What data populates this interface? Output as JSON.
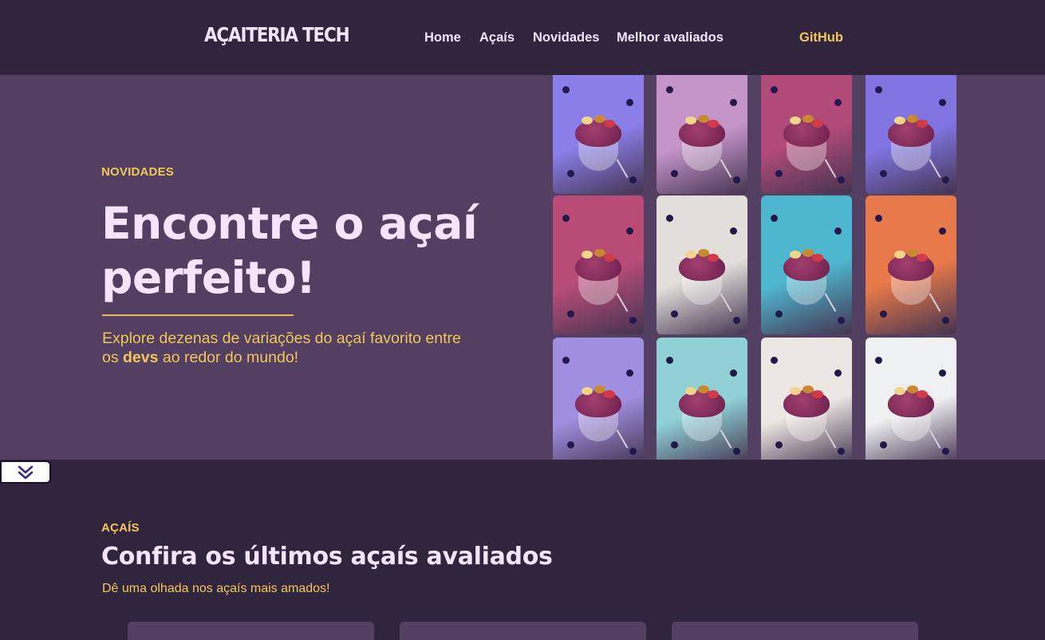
{
  "header": {
    "logo": "AÇAITERIA TECH",
    "nav": [
      {
        "label": "Home"
      },
      {
        "label": "Açaís"
      },
      {
        "label": "Novidades"
      },
      {
        "label": "Melhor avaliados"
      }
    ],
    "github_label": "GitHub"
  },
  "hero": {
    "eyebrow": "NOVIDADES",
    "title": "Encontre o açaí perfeito!",
    "description_before": "Explore dezenas de variações do açaí favorito entre os ",
    "description_highlight": "devs",
    "description_after": " ao redor do mundo!",
    "photos": [
      {
        "name": "acai-photo-glass-on-purple",
        "bg": "#8a7ee8"
      },
      {
        "name": "acai-photo-bowl-on-lilac",
        "bg": "#c594c9"
      },
      {
        "name": "acai-photo-kiwi-on-pink",
        "bg": "#b04a78"
      },
      {
        "name": "acai-photo-goblet-on-purple",
        "bg": "#7f74e0"
      },
      {
        "name": "acai-photo-cup-on-pink",
        "bg": "#b84c77"
      },
      {
        "name": "acai-photo-coconut-bowl",
        "bg": "#e2dfdb"
      },
      {
        "name": "acai-photo-cup-on-cyan",
        "bg": "#4fb6cf"
      },
      {
        "name": "acai-photo-cup-on-orange",
        "bg": "#e8794a"
      },
      {
        "name": "acai-photo-banana-on-lavender",
        "bg": "#a08ee0"
      },
      {
        "name": "acai-photo-cup-on-aqua",
        "bg": "#90d1d6"
      },
      {
        "name": "acai-photo-strawberry-on-white",
        "bg": "#ece7e2"
      },
      {
        "name": "acai-photo-smoothie-on-white",
        "bg": "#eef0f2"
      }
    ]
  },
  "section": {
    "eyebrow": "AÇAÍS",
    "title": "Confira os últimos açaís avaliados",
    "subtitle": "Dê uma olhada nos açaís mais amados!"
  },
  "colors": {
    "background": "#31253d",
    "hero_background": "#523f61",
    "accent": "#f2c65a",
    "heading": "#f6e4ff"
  }
}
